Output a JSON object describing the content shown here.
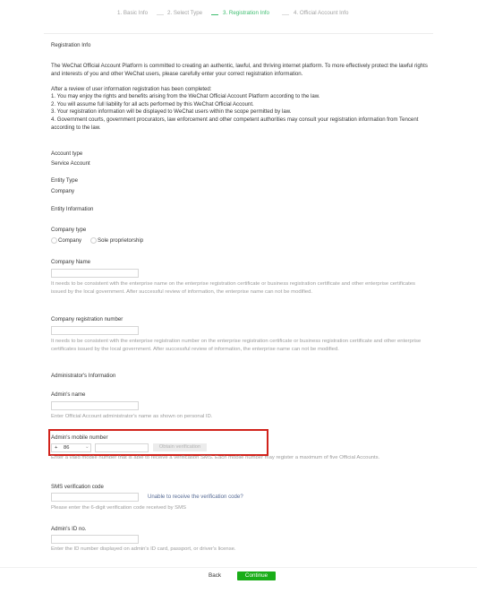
{
  "steps": [
    {
      "label": "1. Basic Info",
      "active": false
    },
    {
      "label": "2. Select Type",
      "active": false
    },
    {
      "label": "3. Registration Info",
      "active": true
    },
    {
      "label": "4. Official Account Info",
      "active": false
    }
  ],
  "registration": {
    "section_title": "Registration Info",
    "intro": "The WeChat Official Account Platform is committed to creating an authentic, lawful, and thriving internet platform. To more effectively protect the lawful rights and interests of you and other WeChat users, please carefully enter your correct registration information.",
    "review_intro": "After a review of user information registration has been completed:",
    "review_points": [
      "1. You may enjoy the rights and benefits arising from the WeChat Official Account Platform according to the law.",
      "2. You will assume full liability for all acts performed by this WeChat Official Account.",
      "3. Your registration information will be displayed to WeChat users within the scope permitted by law.",
      "4. Government courts, government procurators, law enforcement and other competent authorities may consult your registration information from Tencent according to the law."
    ]
  },
  "account_type": {
    "label": "Account type",
    "value": "Service Account"
  },
  "entity_type": {
    "label": "Entity Type",
    "value": "Company"
  },
  "entity_information": {
    "section_title": "Entity Information",
    "company_type_label": "Company type",
    "company_type_options": [
      "Company",
      "Sole proprietorship"
    ],
    "company_name_label": "Company Name",
    "company_name_hint": "It needs to be consistent with the enterprise name on the enterprise registration certificate or business registration certificate and other enterprise certificates issued by the local government. After successful review of information, the enterprise name can not be modified.",
    "company_reg_label": "Company registration number",
    "company_reg_hint": "It needs to be consistent with the enterprise registration number on the enterprise registration certificate or business registration certificate and other enterprise certificates issued by the local government. After successful review of information, the enterprise name can not be modified."
  },
  "admin": {
    "section_title": "Administrator's Information",
    "name_label": "Admin's name",
    "name_hint": "Enter Official Account administrator's name as shown on personal ID.",
    "mobile_label": "Admin's mobile number",
    "country_code_prefix": "+",
    "country_code": "86",
    "obtain_verification": "Obtain verification",
    "mobile_hint": "Enter a valid mobile number that is able to receive a verification SMS. Each mobile number may register a maximum of five Official Accounts.",
    "sms_label": "SMS verification code",
    "sms_link": "Unable to receive the verification code?",
    "sms_hint": "Please enter the 6-digit verification code received by SMS",
    "id_label": "Admin's ID no.",
    "id_hint": "Enter the ID number displayed on admin's ID card, passport, or driver's license."
  },
  "footer": {
    "back": "Back",
    "continue": "Continue"
  },
  "colors": {
    "accent": "#1aad19",
    "highlight": "#d1221b",
    "link": "#576b95"
  }
}
